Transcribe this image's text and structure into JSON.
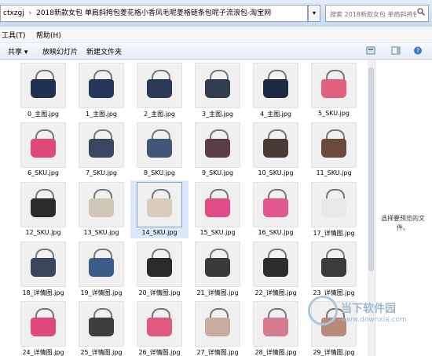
{
  "address": {
    "segments": [
      "ctxzgj",
      "2018新款女包 单肩斜挎包菱花格小香风毛呢菱格链条包呢子流浪包-淘宝网"
    ],
    "separator": "›"
  },
  "search": {
    "placeholder": "搜索 2018新款女包 单肩斜挎包菱花..."
  },
  "menu": {
    "tools": "工具(T)",
    "help": "帮助(H)"
  },
  "toolbar": {
    "share": "共享 ▾",
    "slideshow": "放映幻灯片",
    "new_folder": "新建文件夹"
  },
  "files": [
    {
      "name": "0_主图.jpg",
      "color": "#20324f"
    },
    {
      "name": "1_主图.jpg",
      "color": "#25375a"
    },
    {
      "name": "2_主图.jpg",
      "color": "#2a3a55"
    },
    {
      "name": "3_主图.jpg",
      "color": "#323c4d"
    },
    {
      "name": "4_主图.jpg",
      "color": "#1e2a44"
    },
    {
      "name": "5_SKU.jpg",
      "color": "#e0607e"
    },
    {
      "name": "6_SKU.jpg",
      "color": "#e04a78"
    },
    {
      "name": "7_SKU.jpg",
      "color": "#3b4660"
    },
    {
      "name": "8_SKU.jpg",
      "color": "#44557a"
    },
    {
      "name": "9_SKU.jpg",
      "color": "#5b3d4a"
    },
    {
      "name": "10_SKU.jpg",
      "color": "#4a3a36"
    },
    {
      "name": "11_SKU.jpg",
      "color": "#6a4a3c"
    },
    {
      "name": "12_SKU.jpg",
      "color": "#2b2b2b"
    },
    {
      "name": "13_SKU.jpg",
      "color": "#cfc6b8"
    },
    {
      "name": "14_SKU.jpg",
      "color": "#d8cdbd"
    },
    {
      "name": "15_SKU.jpg",
      "color": "#e04c86"
    },
    {
      "name": "16_SKU.jpg",
      "color": "#e2578e"
    },
    {
      "name": "17_详情图.jpg",
      "color": "#e8e8e8"
    },
    {
      "name": "18_详情图.jpg",
      "color": "#39465c"
    },
    {
      "name": "19_详情图.jpg",
      "color": "#3c5d8a"
    },
    {
      "name": "20_详情图.jpg",
      "color": "#2a2a2a"
    },
    {
      "name": "21_详情图.jpg",
      "color": "#3a3a3a"
    },
    {
      "name": "22_详情图.jpg",
      "color": "#2d2d2d"
    },
    {
      "name": "23_详情图.jpg",
      "color": "#3b3b3b"
    },
    {
      "name": "24_详情图.jpg",
      "color": "#e04a7a"
    },
    {
      "name": "25_详情图.jpg",
      "color": "#3e3e3e"
    },
    {
      "name": "26_详情图.jpg",
      "color": "#e05a80"
    },
    {
      "name": "27_详情图.jpg",
      "color": "#c7aca0"
    },
    {
      "name": "28_详情图.jpg",
      "color": "#d77a90"
    },
    {
      "name": "29_详情图.jpg",
      "color": "#b88a7a"
    }
  ],
  "selected_file": "14_SKU.jpg",
  "preview_text": "选择要预览的文件。",
  "watermark": {
    "title": "当下软件园",
    "url": "www.downxia.com"
  }
}
